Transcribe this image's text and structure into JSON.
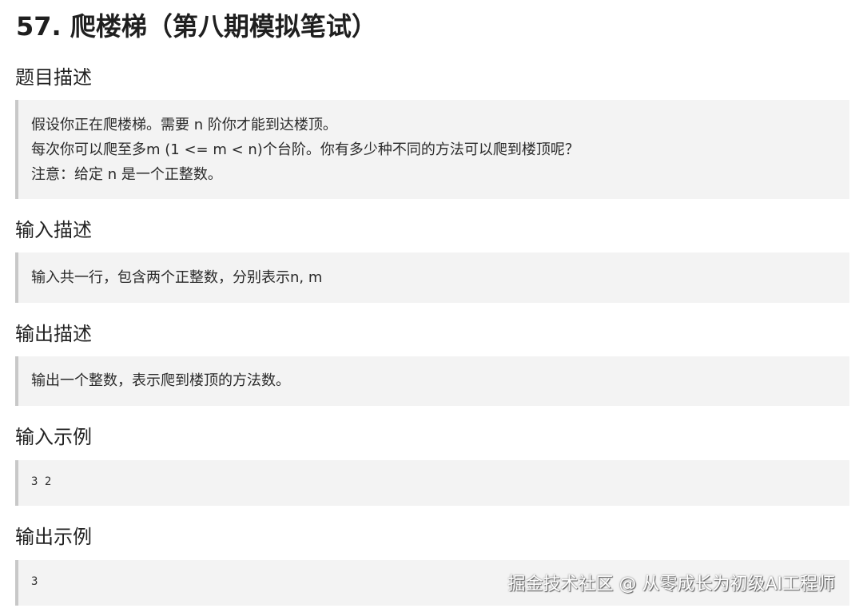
{
  "title": "57. 爬楼梯（第八期模拟笔试）",
  "sections": [
    {
      "heading": "题目描述",
      "lines": [
        "假设你正在爬楼梯。需要 n 阶你才能到达楼顶。",
        "每次你可以爬至多m (1 <= m < n)个台阶。你有多少种不同的方法可以爬到楼顶呢？",
        "注意：给定 n 是一个正整数。"
      ]
    },
    {
      "heading": "输入描述",
      "lines": [
        "输入共一行，包含两个正整数，分别表示n, m"
      ]
    },
    {
      "heading": "输出描述",
      "lines": [
        "输出一个整数，表示爬到楼顶的方法数。"
      ]
    },
    {
      "heading": "输入示例",
      "code": "3 2"
    },
    {
      "heading": "输出示例",
      "code": "3"
    }
  ],
  "watermark": "掘金技术社区 @ 从零成长为初级AI工程师"
}
